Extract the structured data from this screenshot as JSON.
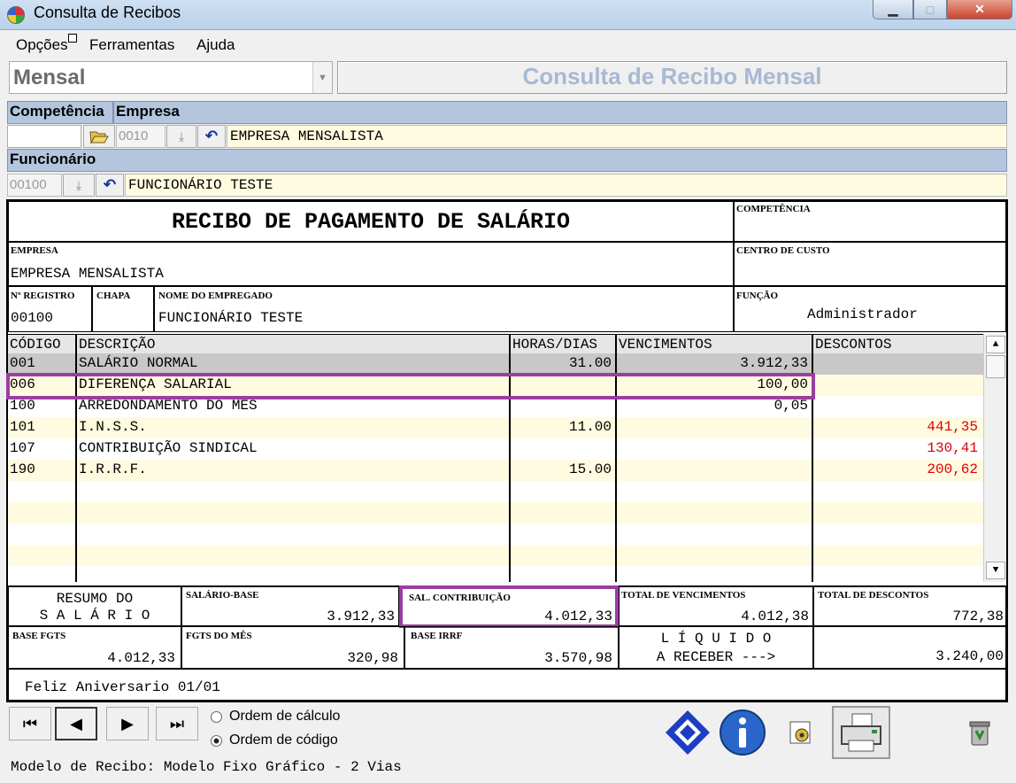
{
  "window": {
    "title": "Consulta de Recibos",
    "icons": [
      "app-globe-icon",
      "minimize-icon",
      "maximize-icon",
      "close-icon"
    ]
  },
  "menu": {
    "items": [
      "Opções",
      "Ferramentas",
      "Ajuda"
    ]
  },
  "period": {
    "value": "Mensal"
  },
  "header": {
    "title": "Consulta de Recibo Mensal"
  },
  "filters": {
    "competencia_label": "Competência",
    "empresa_label": "Empresa",
    "empresa_code": "0010",
    "empresa_name": "EMPRESA MENSALISTA",
    "funcionario_label": "Funcionário",
    "funcionario_code": "00100",
    "funcionario_name": "FUNCIONÁRIO TESTE"
  },
  "receipt": {
    "title": "RECIBO DE PAGAMENTO DE SALÁRIO",
    "competencia_label": "COMPETÊNCIA",
    "empresa_label": "EMPRESA",
    "empresa_value": "EMPRESA MENSALISTA",
    "centro_custo_label": "CENTRO DE CUSTO",
    "registro_label": "Nº REGISTRO",
    "registro_value": "00100",
    "chapa_label": "CHAPA",
    "nome_label": "NOME DO EMPREGADO",
    "nome_value": "FUNCIONÁRIO TESTE",
    "funcao_label": "FUNÇÃO",
    "funcao_value": "Administrador",
    "columns": [
      "CÓDIGO",
      "DESCRIÇÃO",
      "HORAS/DIAS",
      "VENCIMENTOS",
      "DESCONTOS"
    ],
    "rows": [
      {
        "codigo": "001",
        "descricao": "SALÁRIO NORMAL",
        "horas": "31.00",
        "vencimentos": "3.912,33",
        "descontos": ""
      },
      {
        "codigo": "006",
        "descricao": "DIFERENÇA SALARIAL",
        "horas": "",
        "vencimentos": "100,00",
        "descontos": ""
      },
      {
        "codigo": "100",
        "descricao": "ARREDONDAMENTO DO MES",
        "horas": "",
        "vencimentos": "0,05",
        "descontos": ""
      },
      {
        "codigo": "101",
        "descricao": "I.N.S.S.",
        "horas": "11.00",
        "vencimentos": "",
        "descontos": "441,35"
      },
      {
        "codigo": "107",
        "descricao": "CONTRIBUIÇÃO SINDICAL",
        "horas": "",
        "vencimentos": "",
        "descontos": "130,41"
      },
      {
        "codigo": "190",
        "descricao": "I.R.R.F.",
        "horas": "15.00",
        "vencimentos": "",
        "descontos": "200,62"
      }
    ],
    "resumo_line1": "RESUMO DO",
    "resumo_line2": "S A L Á R I O",
    "salario_base_label": "SALÁRIO-BASE",
    "salario_base_value": "3.912,33",
    "sal_contrib_label": "SAL. CONTRIBUIÇÃO",
    "sal_contrib_value": "4.012,33",
    "total_venc_label": "TOTAL DE VENCIMENTOS",
    "total_venc_value": "4.012,38",
    "total_desc_label": "TOTAL DE DESCONTOS",
    "total_desc_value": "772,38",
    "base_fgts_label": "BASE FGTS",
    "base_fgts_value": "4.012,33",
    "fgts_mes_label": "FGTS DO MÊS",
    "fgts_mes_value": "320,98",
    "base_irrf_label": "BASE IRRF",
    "base_irrf_value": "3.570,98",
    "liquido_line1": "L Í Q U I D O",
    "liquido_line2": "A RECEBER --->",
    "liquido_value": "3.240,00",
    "message": "Feliz Aniversario 01/01"
  },
  "footer": {
    "order_calc": "Ordem de cálculo",
    "order_code": "Ordem de código",
    "model": "Modelo de Recibo: Modelo Fixo Gráfico - 2 Vias"
  },
  "colors": {
    "accent_purple": "#9b3ea0",
    "discount_red": "#e00000",
    "band_blue": "#b4c6dd"
  }
}
